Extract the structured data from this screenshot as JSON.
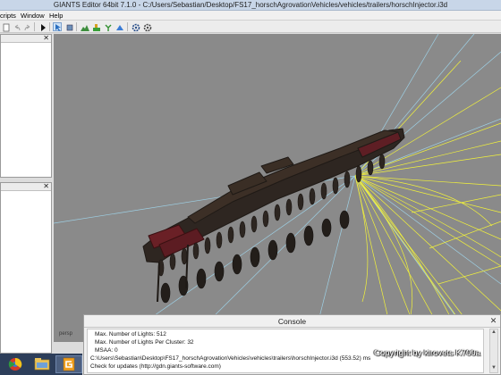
{
  "window": {
    "title": "GIANTS Editor 64bit 7.1.0 - C:/Users/Sebastian/Desktop/FS17_horschAgrovationVehicles/vehicles/trailers/horschInjector.i3d"
  },
  "menu": {
    "items": [
      "cripts",
      "Window",
      "Help"
    ]
  },
  "toolbar": {
    "icons": [
      "undo-icon",
      "redo-icon",
      "play-icon",
      "select-icon",
      "move-icon",
      "terrain-icon",
      "paint-icon",
      "foliage-icon",
      "settings-icon",
      "shader-icon"
    ]
  },
  "viewport": {
    "camera_label": "persp",
    "background": "#8a8a8a",
    "light_ray_colors": [
      "#f2f23a",
      "#9fd4ea"
    ]
  },
  "console": {
    "title": "Console",
    "lines": [
      "Max. Number of Lights: 512",
      "Max. Number of Lights Per Cluster: 32",
      "MSAA: 0",
      "C:\\Users\\Sebastian\\Desktop\\FS17_horschAgrovationVehicles\\vehicles\\trailers\\horschInjector.i3d (553.52) ms",
      "Check for updates (http://gdn.giants-software.com)"
    ]
  },
  "watermark": {
    "text": "Copyright by kirovets K700a"
  },
  "taskbar": {
    "apps": [
      "browser-app",
      "file-explorer-app",
      "giants-editor-app"
    ]
  }
}
